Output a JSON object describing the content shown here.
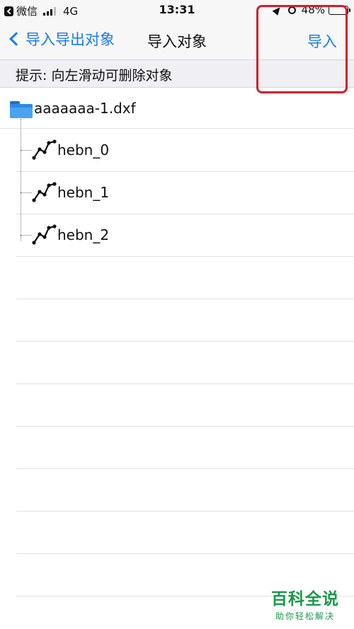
{
  "status_bar": {
    "carrier": "微信",
    "network": "4G",
    "time": "13:31",
    "battery": "48%",
    "battery_level": 0.48
  },
  "nav": {
    "back_label": "导入导出对象",
    "title": "导入对象",
    "action_label": "导入",
    "accent_color": "#1a7ce8",
    "highlight_color": "#d1202c"
  },
  "hint": {
    "text": "提示: 向左滑动可删除对象"
  },
  "tree": {
    "file": {
      "icon": "folder-icon",
      "name": "aaaaaaa-1.dxf"
    },
    "layers": [
      {
        "icon": "polyline-icon",
        "name": "hebn_0"
      },
      {
        "icon": "polyline-icon",
        "name": "hebn_1"
      },
      {
        "icon": "polyline-icon",
        "name": "hebn_2"
      }
    ]
  },
  "watermark": {
    "title": "百科全说",
    "subtitle": "助你轻松解决"
  }
}
